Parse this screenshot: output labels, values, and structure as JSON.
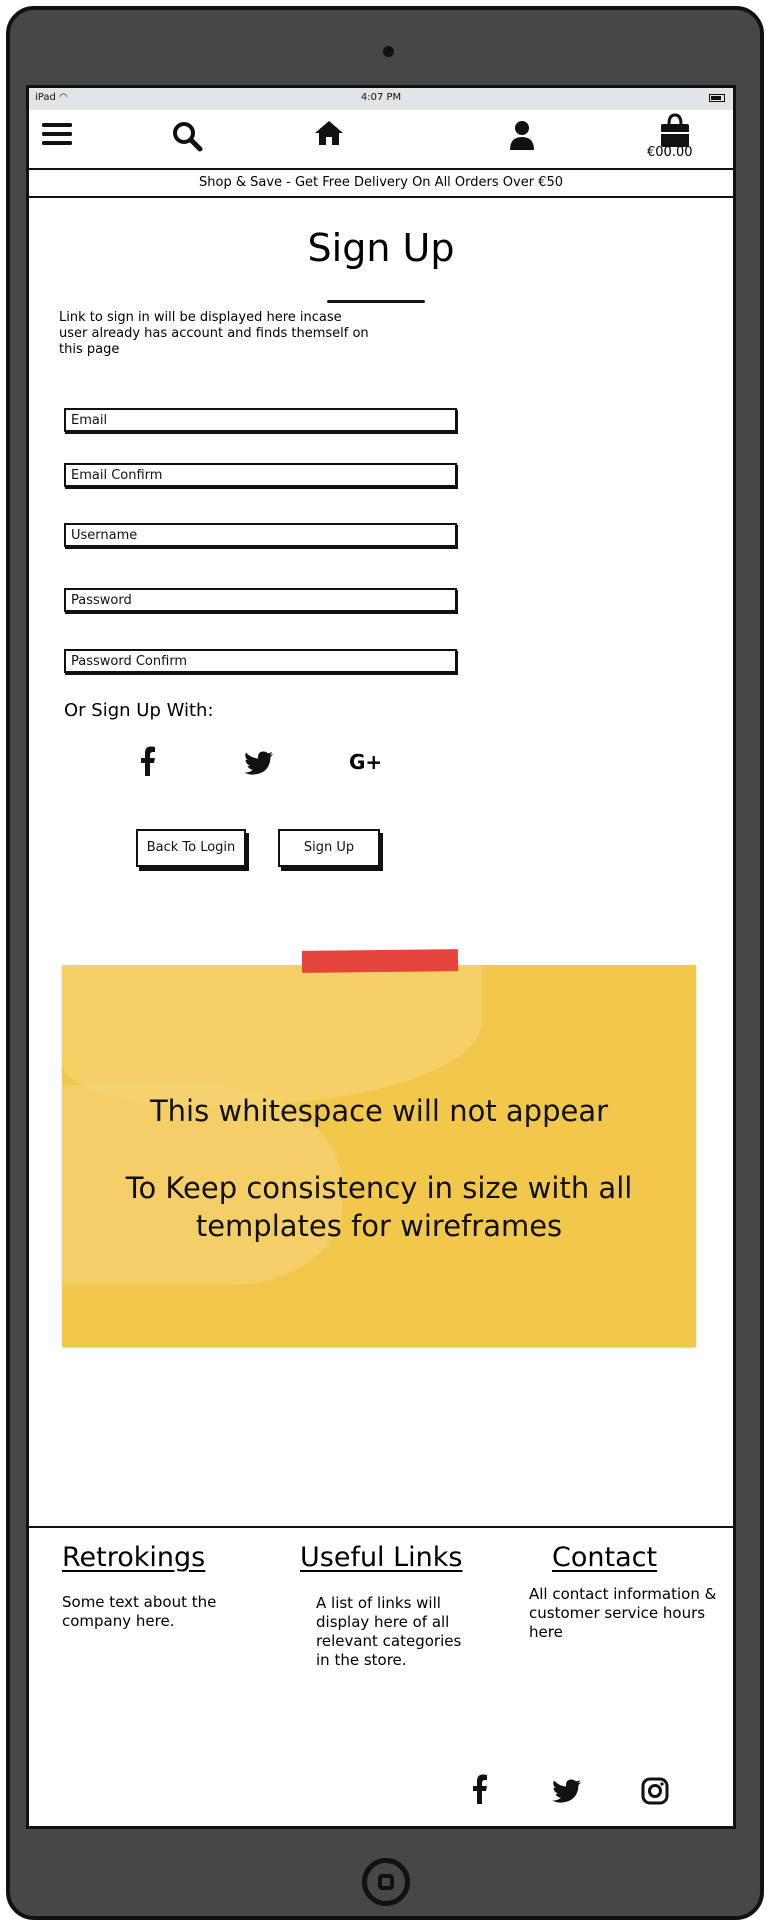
{
  "status_bar": {
    "device": "iPad",
    "time": "4:07 PM"
  },
  "nav": {
    "cart_total": "€00.00"
  },
  "banner": {
    "text": "Shop & Save - Get Free Delivery On All Orders Over €50"
  },
  "page": {
    "title": "Sign Up",
    "note": "Link to sign in will be displayed here incase user already has account and finds themself on this page"
  },
  "form": {
    "email_placeholder": "Email",
    "email_confirm_placeholder": "Email Confirm",
    "username_placeholder": "Username",
    "password_placeholder": "Password",
    "password_confirm_placeholder": "Password Confirm"
  },
  "social": {
    "label": "Or Sign Up With:",
    "google_label": "G+"
  },
  "buttons": {
    "back": "Back To Login",
    "signup": "Sign Up"
  },
  "sticky_note": {
    "line1": "This whitespace will not appear",
    "line2": "To Keep consistency in size with all templates for wireframes"
  },
  "footer": {
    "col1_title": "Retrokings",
    "col1_text": "Some text about the company here.",
    "col2_title": "Useful Links",
    "col2_text": "A list of links will display here of all relevant categories in the store.",
    "col3_title": "Contact",
    "col3_text": "All contact information & customer service hours here"
  },
  "colors": {
    "device": "#474747",
    "sticky": "#f2c84c",
    "tape": "#e5453b",
    "status_bar": "#e2e5e8"
  }
}
